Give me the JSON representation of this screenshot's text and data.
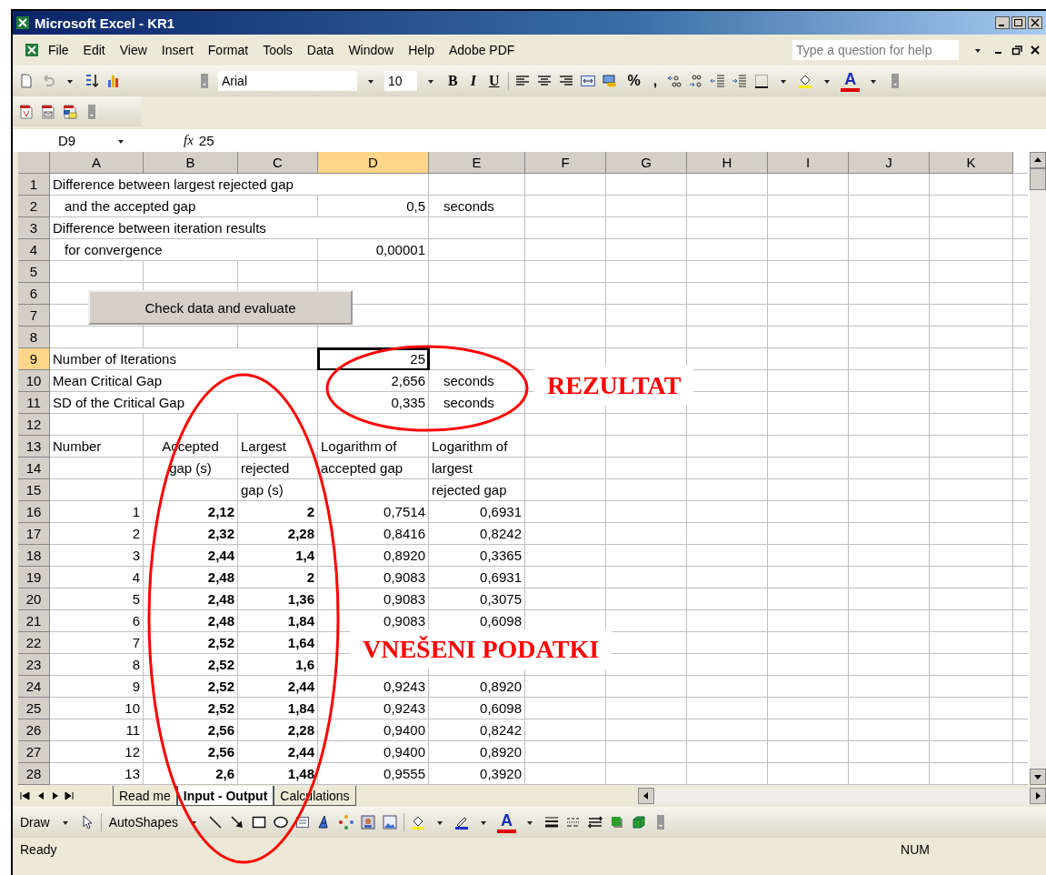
{
  "window": {
    "title": "Microsoft Excel - KR1"
  },
  "menu": [
    {
      "label": "File"
    },
    {
      "label": "Edit"
    },
    {
      "label": "View"
    },
    {
      "label": "Insert"
    },
    {
      "label": "Format"
    },
    {
      "label": "Tools"
    },
    {
      "label": "Data"
    },
    {
      "label": "Window"
    },
    {
      "label": "Help"
    },
    {
      "label": "Adobe PDF"
    }
  ],
  "help_field": {
    "placeholder": "Type a question for help"
  },
  "formatting": {
    "font": "Arial",
    "size": "10",
    "style_buttons": [
      "B",
      "I",
      "U"
    ],
    "number_buttons": [
      "%",
      ","
    ],
    "font_color_letter": "A"
  },
  "formula_bar": {
    "name_box": "D9",
    "function_symbol": "fx",
    "value": "25"
  },
  "grid": {
    "columns": [
      {
        "label": "A",
        "selected": false
      },
      {
        "label": "B",
        "selected": false
      },
      {
        "label": "C",
        "selected": false
      },
      {
        "label": "D",
        "selected": true
      },
      {
        "label": "E",
        "selected": false
      },
      {
        "label": "F",
        "selected": false
      },
      {
        "label": "G",
        "selected": false
      },
      {
        "label": "H",
        "selected": false
      },
      {
        "label": "I",
        "selected": false
      },
      {
        "label": "J",
        "selected": false
      },
      {
        "label": "K",
        "selected": false
      }
    ],
    "rows": [
      {
        "number": "1",
        "selected": false,
        "cells": [
          {
            "kind": "text",
            "text": "Difference between largest rejected gap"
          }
        ]
      },
      {
        "number": "2",
        "selected": false,
        "cells": [
          {
            "kind": "indent",
            "text": "and the accepted gap"
          },
          {
            "kind": "empty"
          },
          {
            "kind": "empty"
          },
          {
            "kind": "number",
            "text": "0,5"
          },
          {
            "kind": "indent",
            "text": "seconds"
          }
        ]
      },
      {
        "number": "3",
        "selected": false,
        "cells": [
          {
            "kind": "text",
            "text": "Difference between iteration results"
          }
        ]
      },
      {
        "number": "4",
        "selected": false,
        "cells": [
          {
            "kind": "indent",
            "text": "for convergence"
          },
          {
            "kind": "empty"
          },
          {
            "kind": "empty"
          },
          {
            "kind": "number",
            "text": "0,00001"
          }
        ]
      },
      {
        "number": "5",
        "selected": false,
        "cells": []
      },
      {
        "number": "6",
        "selected": false,
        "cells": []
      },
      {
        "number": "7",
        "selected": false,
        "cells": []
      },
      {
        "number": "8",
        "selected": false,
        "cells": []
      },
      {
        "number": "9",
        "selected": true,
        "cells": [
          {
            "kind": "text",
            "text": "Number of Iterations"
          },
          {
            "kind": "empty"
          },
          {
            "kind": "empty"
          },
          {
            "kind": "number",
            "text": "25"
          }
        ]
      },
      {
        "number": "10",
        "selected": false,
        "cells": [
          {
            "kind": "text",
            "text": "Mean Critical Gap"
          },
          {
            "kind": "empty"
          },
          {
            "kind": "empty"
          },
          {
            "kind": "number",
            "text": "2,656"
          },
          {
            "kind": "indent",
            "text": "seconds"
          }
        ]
      },
      {
        "number": "11",
        "selected": false,
        "cells": [
          {
            "kind": "text",
            "text": "SD of the Critical Gap"
          },
          {
            "kind": "empty"
          },
          {
            "kind": "empty"
          },
          {
            "kind": "number",
            "text": "0,335"
          },
          {
            "kind": "indent",
            "text": "seconds"
          }
        ]
      },
      {
        "number": "12",
        "selected": false,
        "cells": []
      },
      {
        "number": "13",
        "selected": false,
        "cells": [
          {
            "kind": "label",
            "text": "Number"
          },
          {
            "kind": "center",
            "text": "Accepted"
          },
          {
            "kind": "label",
            "text": "Largest"
          },
          {
            "kind": "label",
            "text": "Logarithm of"
          },
          {
            "kind": "label",
            "text": "Logarithm of"
          }
        ]
      },
      {
        "number": "14",
        "selected": false,
        "cells": [
          {
            "kind": "empty"
          },
          {
            "kind": "center",
            "text": "gap (s)"
          },
          {
            "kind": "label",
            "text": "rejected"
          },
          {
            "kind": "label",
            "text": "accepted gap"
          },
          {
            "kind": "label",
            "text": "largest"
          }
        ]
      },
      {
        "number": "15",
        "selected": false,
        "cells": [
          {
            "kind": "empty"
          },
          {
            "kind": "empty"
          },
          {
            "kind": "label",
            "text": "gap (s)"
          },
          {
            "kind": "empty"
          },
          {
            "kind": "label",
            "text": "rejected gap"
          }
        ]
      },
      {
        "number": "16",
        "selected": false,
        "cells": [
          {
            "kind": "number",
            "text": "1"
          },
          {
            "kind": "input",
            "text": "2,12"
          },
          {
            "kind": "input",
            "text": "2"
          },
          {
            "kind": "number",
            "text": "0,7514"
          },
          {
            "kind": "number",
            "text": "0,6931"
          }
        ]
      },
      {
        "number": "17",
        "selected": false,
        "cells": [
          {
            "kind": "number",
            "text": "2"
          },
          {
            "kind": "input",
            "text": "2,32"
          },
          {
            "kind": "input",
            "text": "2,28"
          },
          {
            "kind": "number",
            "text": "0,8416"
          },
          {
            "kind": "number",
            "text": "0,8242"
          }
        ]
      },
      {
        "number": "18",
        "selected": false,
        "cells": [
          {
            "kind": "number",
            "text": "3"
          },
          {
            "kind": "input",
            "text": "2,44"
          },
          {
            "kind": "input",
            "text": "1,4"
          },
          {
            "kind": "number",
            "text": "0,8920"
          },
          {
            "kind": "number",
            "text": "0,3365"
          }
        ]
      },
      {
        "number": "19",
        "selected": false,
        "cells": [
          {
            "kind": "number",
            "text": "4"
          },
          {
            "kind": "input",
            "text": "2,48"
          },
          {
            "kind": "input",
            "text": "2"
          },
          {
            "kind": "number",
            "text": "0,9083"
          },
          {
            "kind": "number",
            "text": "0,6931"
          }
        ]
      },
      {
        "number": "20",
        "selected": false,
        "cells": [
          {
            "kind": "number",
            "text": "5"
          },
          {
            "kind": "input",
            "text": "2,48"
          },
          {
            "kind": "input",
            "text": "1,36"
          },
          {
            "kind": "number",
            "text": "0,9083"
          },
          {
            "kind": "number",
            "text": "0,3075"
          }
        ]
      },
      {
        "number": "21",
        "selected": false,
        "cells": [
          {
            "kind": "number",
            "text": "6"
          },
          {
            "kind": "input",
            "text": "2,48"
          },
          {
            "kind": "input",
            "text": "1,84"
          },
          {
            "kind": "number",
            "text": "0,9083"
          },
          {
            "kind": "number",
            "text": "0,6098"
          }
        ]
      },
      {
        "number": "22",
        "selected": false,
        "cells": [
          {
            "kind": "number",
            "text": "7"
          },
          {
            "kind": "input",
            "text": "2,52"
          },
          {
            "kind": "input",
            "text": "1,64"
          }
        ]
      },
      {
        "number": "23",
        "selected": false,
        "cells": [
          {
            "kind": "number",
            "text": "8"
          },
          {
            "kind": "input",
            "text": "2,52"
          },
          {
            "kind": "input",
            "text": "1,6"
          }
        ]
      },
      {
        "number": "24",
        "selected": false,
        "cells": [
          {
            "kind": "number",
            "text": "9"
          },
          {
            "kind": "input",
            "text": "2,52"
          },
          {
            "kind": "input",
            "text": "2,44"
          },
          {
            "kind": "number",
            "text": "0,9243"
          },
          {
            "kind": "number",
            "text": "0,8920"
          }
        ]
      },
      {
        "number": "25",
        "selected": false,
        "cells": [
          {
            "kind": "number",
            "text": "10"
          },
          {
            "kind": "input",
            "text": "2,52"
          },
          {
            "kind": "input",
            "text": "1,84"
          },
          {
            "kind": "number",
            "text": "0,9243"
          },
          {
            "kind": "number",
            "text": "0,6098"
          }
        ]
      },
      {
        "number": "26",
        "selected": false,
        "cells": [
          {
            "kind": "number",
            "text": "11"
          },
          {
            "kind": "input",
            "text": "2,56"
          },
          {
            "kind": "input",
            "text": "2,28"
          },
          {
            "kind": "number",
            "text": "0,9400"
          },
          {
            "kind": "number",
            "text": "0,8242"
          }
        ]
      },
      {
        "number": "27",
        "selected": false,
        "cells": [
          {
            "kind": "number",
            "text": "12"
          },
          {
            "kind": "input",
            "text": "2,56"
          },
          {
            "kind": "input",
            "text": "2,44"
          },
          {
            "kind": "number",
            "text": "0,9400"
          },
          {
            "kind": "number",
            "text": "0,8920"
          }
        ]
      },
      {
        "number": "28",
        "selected": false,
        "cells": [
          {
            "kind": "number",
            "text": "13"
          },
          {
            "kind": "input",
            "text": "2,6"
          },
          {
            "kind": "input",
            "text": "1,48"
          },
          {
            "kind": "number",
            "text": "0,9555"
          },
          {
            "kind": "number",
            "text": "0,3920"
          }
        ]
      }
    ]
  },
  "sheet_button": {
    "label": "Check data and evaluate"
  },
  "annotations": [
    {
      "text": "REZULTAT"
    },
    {
      "text": "VNEŠENI PODATKI"
    }
  ],
  "sheet_tabs": [
    {
      "label": "Read me",
      "selected": false
    },
    {
      "label": "Input - Output",
      "selected": true
    },
    {
      "label": "Calculations",
      "selected": false
    }
  ],
  "drawing_toolbar": {
    "draw": "Draw",
    "autoshapes": "AutoShapes",
    "font_color_letter": "A"
  },
  "status_bar": {
    "text": "Ready",
    "indicator": "NUM"
  }
}
